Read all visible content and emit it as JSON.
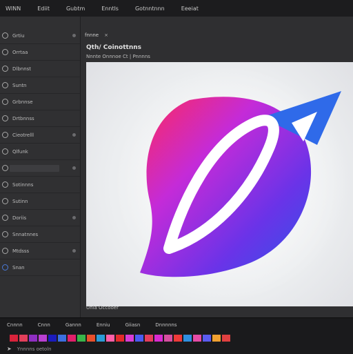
{
  "menu": [
    "WINN",
    "Ediit",
    "Gubtm",
    "Enntls",
    "Gotnntnnn",
    "Eeeiat"
  ],
  "sidebar": {
    "items": [
      {
        "label": "Grtiu"
      },
      {
        "label": "Orrtaa"
      },
      {
        "label": "Dlbnnst"
      },
      {
        "label": "Suntn"
      },
      {
        "label": "Grbnnse"
      },
      {
        "label": "Drtbnnss"
      },
      {
        "label": "Cieotrelll"
      },
      {
        "label": "Qlfunk"
      },
      {
        "label": ""
      },
      {
        "label": "Sotinnns"
      },
      {
        "label": "Sutinn"
      },
      {
        "label": "Doriis"
      },
      {
        "label": "Snnatnnes"
      },
      {
        "label": "Mtdsss"
      },
      {
        "label": "Snan"
      }
    ]
  },
  "tabs": {
    "label": "fnnne"
  },
  "title": "Qth/ Coinottnns",
  "subtitle": "Nnnte Onnnoe Ct | Pnnnns",
  "status": "Unla Occooer",
  "bottom": {
    "labels": [
      "Cnnnn",
      "Cnnn",
      "Gannn",
      "Enniu",
      "Giiasn",
      "Dnnnnns"
    ],
    "status_text": "Ynnnns oetoln",
    "swatches": [
      "#d9233b",
      "#e23f5a",
      "#8f2ec2",
      "#b93fd1",
      "#1b1bbd",
      "#3b6fe0",
      "#e01f6a",
      "#39b54a",
      "#e84f2b",
      "#2a9bd6",
      "#ff5fa8",
      "#e22a2a",
      "#d83cd6",
      "#4a5bf0",
      "#e53d5c",
      "#d92ad0",
      "#d64ea0",
      "#ef3a3a",
      "#2f8fe0",
      "#e54ca6",
      "#5a5cf0",
      "#f0a030",
      "#e04040"
    ]
  },
  "icons": {
    "sidebar_row": "radio-circle-icon",
    "status_arrow": "cursor-arrow-icon",
    "logo": "planet-leaf-logo"
  },
  "colors": {
    "logo_gradient": [
      "#ff1f5b",
      "#c02bd9",
      "#6a33e8",
      "#2f5be8"
    ]
  }
}
